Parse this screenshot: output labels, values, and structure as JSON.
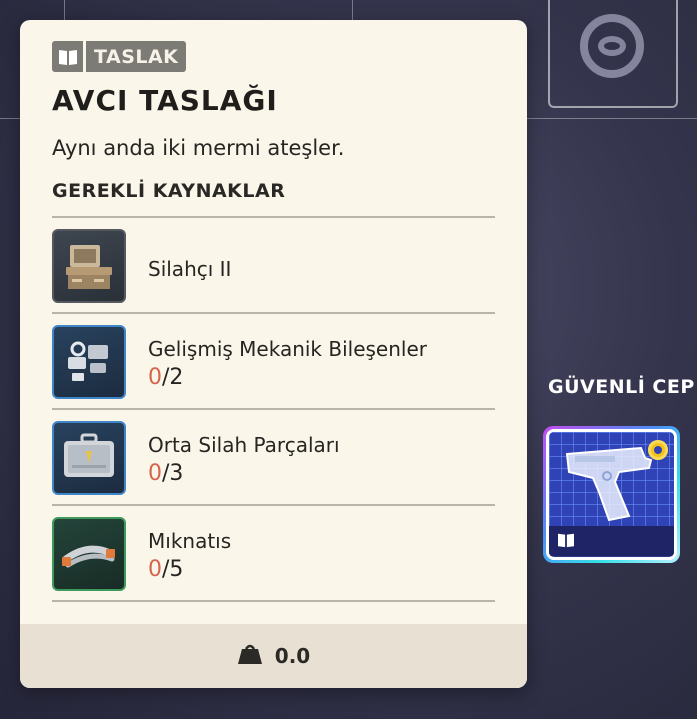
{
  "tag": {
    "icon": "book-icon",
    "label": "TASLAK"
  },
  "item": {
    "title": "AVCI TASLAĞI",
    "description": "Aynı anda iki mermi ateşler."
  },
  "requirements": {
    "header": "GEREKLİ KAYNAKLAR",
    "items": [
      {
        "name": "Silahçı II",
        "thumb": "workbench-icon",
        "rarity": "common"
      },
      {
        "name": "Gelişmiş Mekanik Bileşenler",
        "have": "0",
        "need": "/2",
        "thumb": "mechanical-parts-icon",
        "rarity": "rare"
      },
      {
        "name": "Orta Silah Parçaları",
        "have": "0",
        "need": "/3",
        "thumb": "weapon-parts-case-icon",
        "rarity": "rare"
      },
      {
        "name": "Mıknatıs",
        "have": "0",
        "need": "/5",
        "thumb": "magnet-icon",
        "rarity": "uncommon"
      }
    ]
  },
  "footer": {
    "weight_icon": "weight-icon",
    "weight": "0.0"
  },
  "secure_pocket": {
    "label": "GÜVENLİ CEP",
    "item_icon": "pistol-blueprint-icon",
    "badge_icon": "book-icon",
    "coin_icon": "coin-icon"
  },
  "colors": {
    "card_bg": "#fbf6ea",
    "tag_bg": "#7d7b75",
    "count_have": "#d4654f",
    "rare_border": "#3f86c8",
    "uncommon_border": "#3e9a5c"
  }
}
